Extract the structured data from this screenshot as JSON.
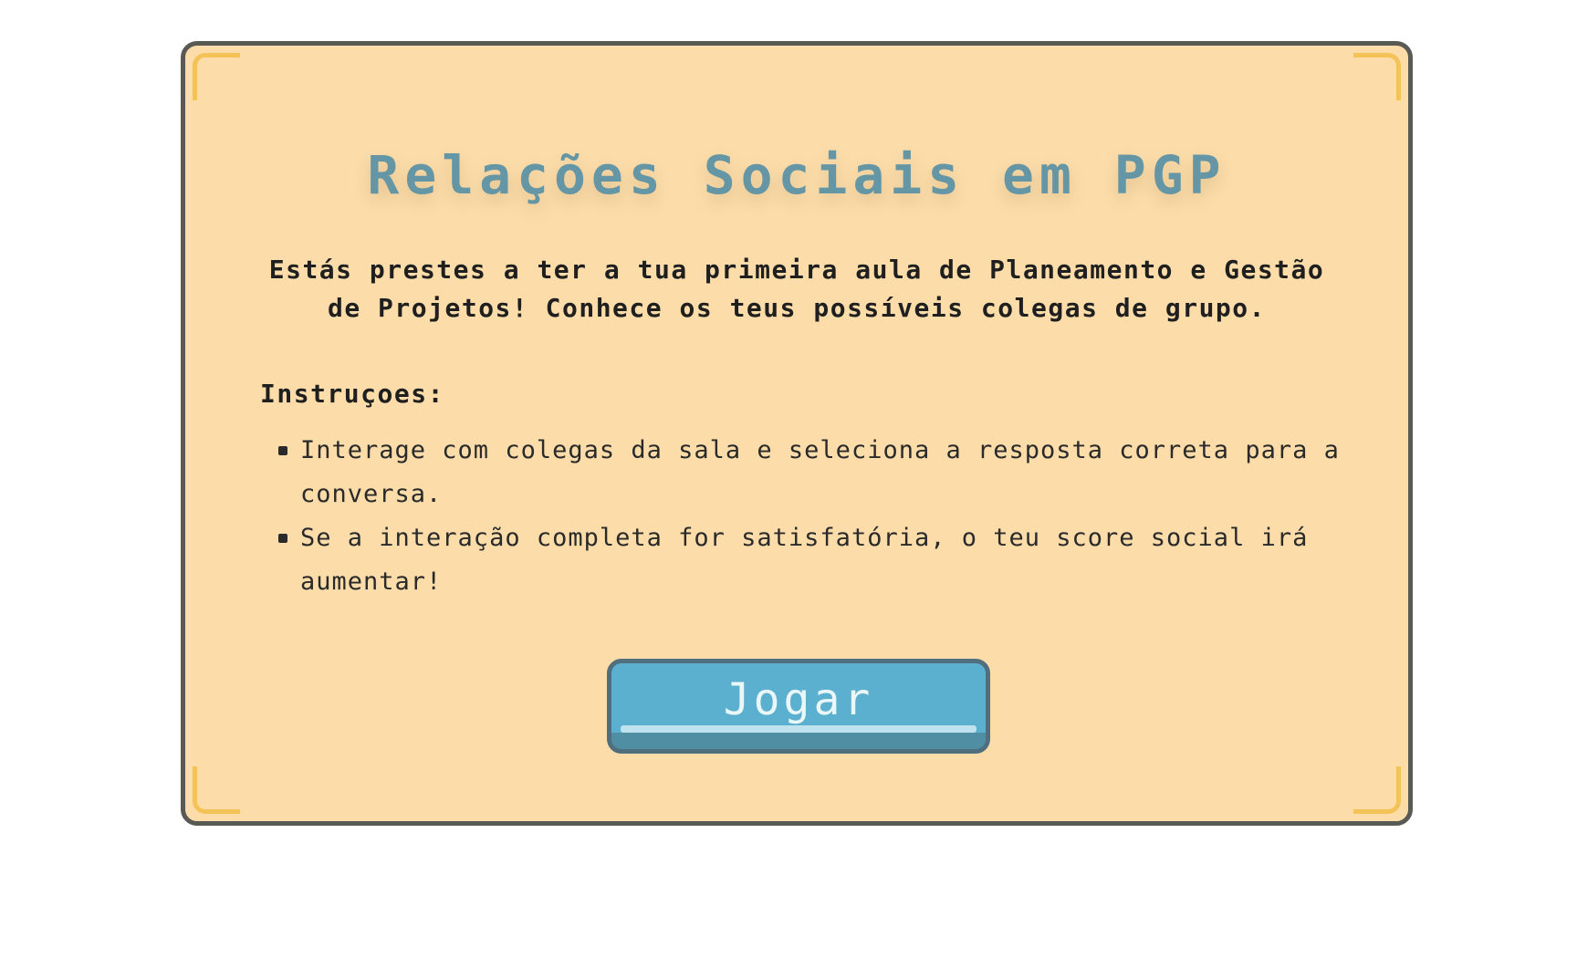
{
  "dialog": {
    "title": "Relações Sociais em PGP",
    "intro": "Estás prestes a ter a tua primeira aula de Planeamento e Gestão de Projetos! Conhece os teus possíveis colegas de grupo.",
    "instructions_heading": "Instruçoes:",
    "instructions": [
      "Interage com colegas da sala e seleciona a resposta correta para a conversa.",
      "Se a interação completa for satisfatória, o teu score social irá aumentar!"
    ],
    "play_label": "Jogar"
  },
  "colors": {
    "panel_bg": "#fcddaa",
    "panel_border": "#5a5a54",
    "corner_accent": "#f5c258",
    "title": "#6596a6",
    "button": "#5cb0cf",
    "button_border": "#4f6f7e"
  },
  "icons": [
    "bullet-icon"
  ]
}
